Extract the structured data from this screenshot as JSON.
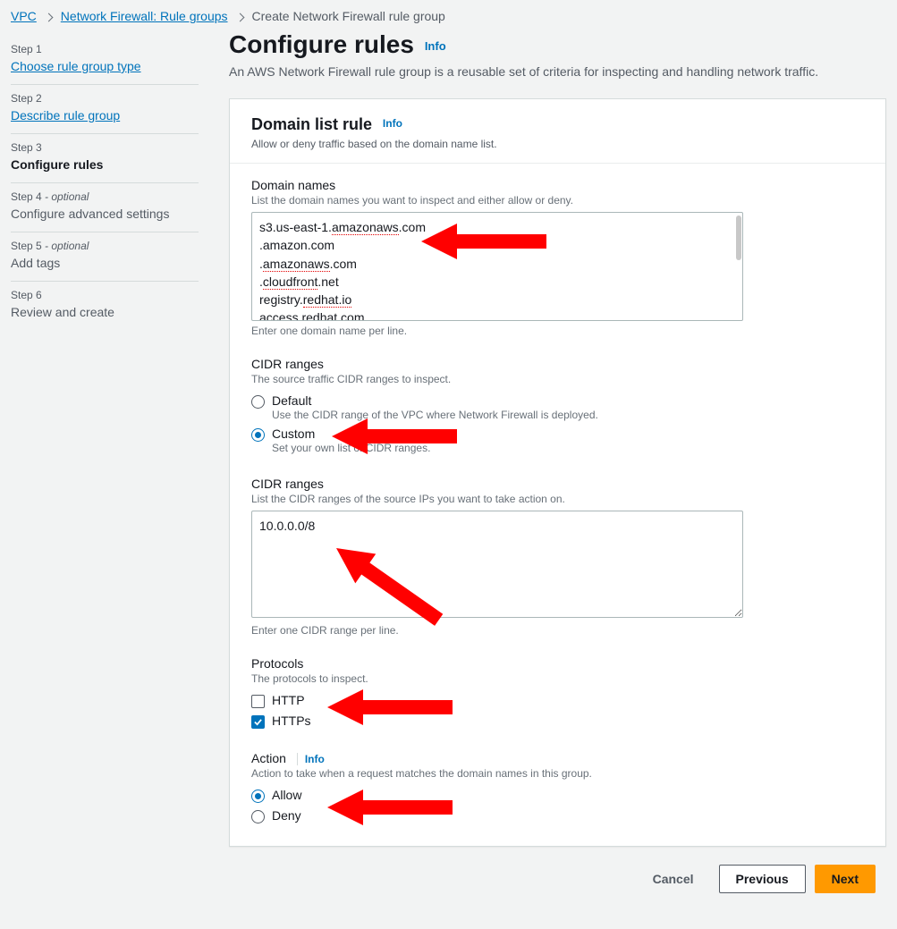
{
  "breadcrumb": {
    "vpc": "VPC",
    "rule_groups": "Network Firewall: Rule groups",
    "current": "Create Network Firewall rule group"
  },
  "sidebar": {
    "steps": [
      {
        "label": "Step 1",
        "title": "Choose rule group type",
        "link": true
      },
      {
        "label": "Step 2",
        "title": "Describe rule group",
        "link": true
      },
      {
        "label": "Step 3",
        "title": "Configure rules",
        "current": true
      },
      {
        "label": "Step 4",
        "optional": "- optional",
        "title": "Configure advanced settings"
      },
      {
        "label": "Step 5",
        "optional": "- optional",
        "title": "Add tags"
      },
      {
        "label": "Step 6",
        "title": "Review and create"
      }
    ]
  },
  "info_label": "Info",
  "page": {
    "title": "Configure rules",
    "subtitle": "An AWS Network Firewall rule group is a reusable set of criteria for inspecting and handling network traffic."
  },
  "panel": {
    "title": "Domain list rule",
    "hint": "Allow or deny traffic based on the domain name list."
  },
  "domain_names": {
    "label": "Domain names",
    "hint": "List the domain names you want to inspect and either allow or deny.",
    "value": "s3.us-east-1.amazonaws.com\n.amazon.com\n.amazonaws.com\n.cloudfront.net\nregistry.redhat.io\naccess.redhat.com",
    "footnote": "Enter one domain name per line."
  },
  "cidr_mode": {
    "label": "CIDR ranges",
    "hint": "The source traffic CIDR ranges to inspect.",
    "options": {
      "default": {
        "label": "Default",
        "desc": "Use the CIDR range of the VPC where Network Firewall is deployed."
      },
      "custom": {
        "label": "Custom",
        "desc": "Set your own list of CIDR ranges."
      }
    },
    "selected": "custom"
  },
  "cidr_ranges": {
    "label": "CIDR ranges",
    "hint": "List the CIDR ranges of the source IPs you want to take action on.",
    "value": "10.0.0.0/8",
    "footnote": "Enter one CIDR range per line."
  },
  "protocols": {
    "label": "Protocols",
    "hint": "The protocols to inspect.",
    "http": {
      "label": "HTTP",
      "checked": false
    },
    "https": {
      "label": "HTTPs",
      "checked": true
    }
  },
  "action": {
    "label": "Action",
    "hint": "Action to take when a request matches the domain names in this group.",
    "allow": "Allow",
    "deny": "Deny",
    "selected": "allow"
  },
  "footer": {
    "cancel": "Cancel",
    "previous": "Previous",
    "next": "Next"
  },
  "annotation_color": "#ff0000"
}
